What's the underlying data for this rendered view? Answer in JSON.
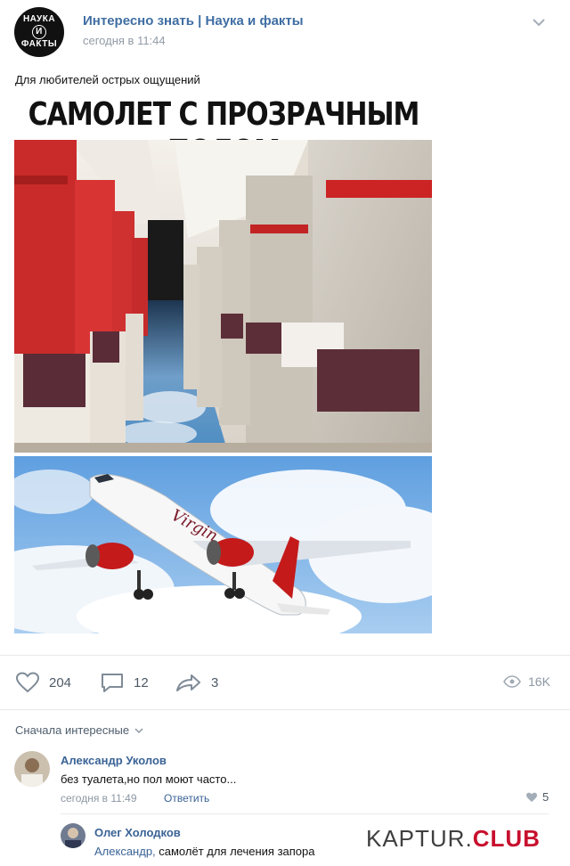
{
  "post": {
    "group_name": "Интересно знать | Наука и факты",
    "time": "сегодня в 11:44",
    "text": "Для любителей острых ощущений",
    "avatar_lines": [
      "НАУКА",
      "И",
      "ФАКТЫ"
    ],
    "banner": "САМОЛЕТ С ПРОЗРАЧНЫМ ПОЛОМ",
    "plane_livery": "Virgin"
  },
  "actions": {
    "likes": "204",
    "comments": "12",
    "shares": "3",
    "views": "16K"
  },
  "sort_label": "Сначала интересные",
  "comments": [
    {
      "author": "Александр Уколов",
      "text": "без туалета,но пол моют часто...",
      "time": "сегодня в 11:49",
      "reply": "Ответить",
      "likes": "5"
    },
    {
      "author": "Олег Холодков",
      "mention": "Александр,",
      "text": " самолёт для лечения запора"
    }
  ],
  "watermark": {
    "part1": "KAPTUR.",
    "part2": "CLUB"
  },
  "colors": {
    "link": "#3f6ea3",
    "muted": "#929ba5",
    "seat_red": "#d42a2a",
    "sky": "#7db3e6"
  }
}
